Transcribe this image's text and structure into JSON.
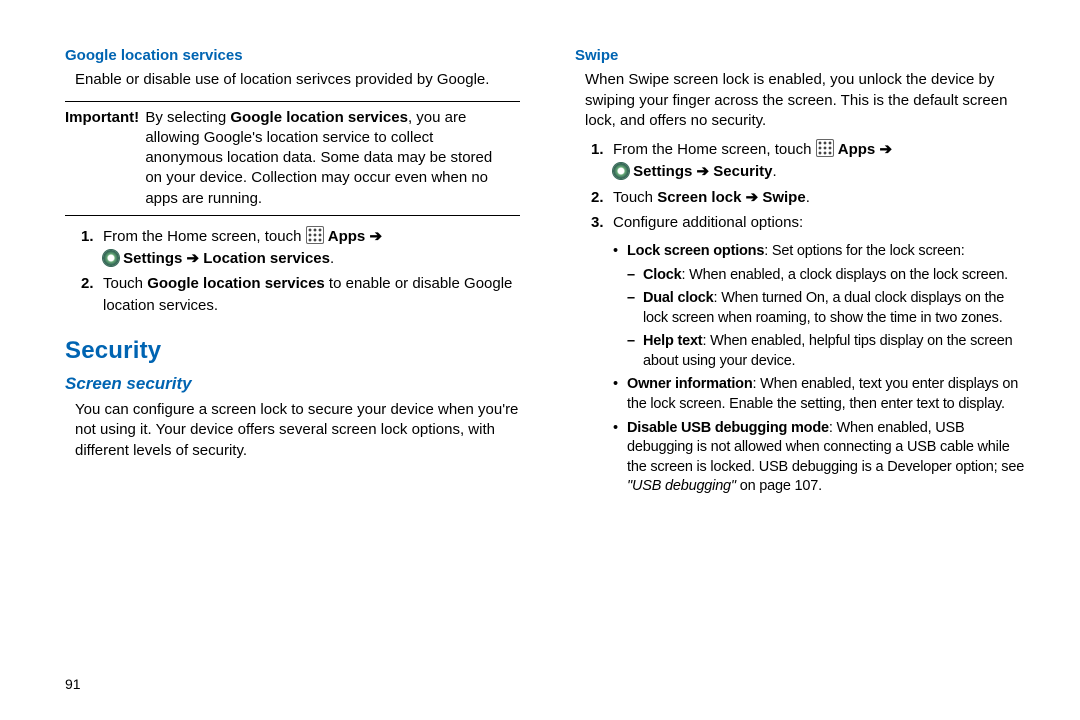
{
  "left": {
    "h_google": "Google location services",
    "google_intro": "Enable or disable use of location serivces provided by Google.",
    "important_label": "Important!",
    "important_a": "By selecting ",
    "important_b": "Google location services",
    "important_c": ", you are allowing Google's location service to collect anonymous location data. Some data may be stored on your device. Collection may occur even when no apps are running.",
    "step1_a": "From the Home screen, touch ",
    "step1_apps": " Apps ",
    "arrow": "➔",
    "step1_settings": " Settings ",
    "step1_loc": " Location services",
    "step2_a": "Touch ",
    "step2_b": "Google location services",
    "step2_c": " to enable or disable Google location services.",
    "h_security": "Security",
    "h_screen": "Screen security",
    "screen_para": "You can configure a screen lock to secure your device when you're not using it. Your device offers several screen lock options, with different levels of security."
  },
  "right": {
    "h_swipe": "Swipe",
    "swipe_intro": "When Swipe screen lock is enabled, you unlock the device by swiping your finger across the screen. This is the default screen lock, and offers no security.",
    "step1_a": "From the Home screen, touch ",
    "step1_apps": " Apps ",
    "arrow": "➔",
    "step1_settings": " Settings ",
    "step1_security": " Security",
    "step2_a": "Touch ",
    "step2_b": "Screen lock ",
    "step2_c": " Swipe",
    "period": ".",
    "step3": "Configure additional options:",
    "b1_a": "Lock screen options",
    "b1_b": ": Set options for the lock screen:",
    "d1_a": "Clock",
    "d1_b": ": When enabled, a clock displays on the lock screen.",
    "d2_a": "Dual clock",
    "d2_b": ": When turned On, a dual clock displays on the lock screen when roaming, to show the time in two zones.",
    "d3_a": "Help text",
    "d3_b": ": When enabled, helpful tips display on the screen about using your device.",
    "b2_a": "Owner information",
    "b2_b": ": When enabled, text you enter displays on the lock screen. Enable the setting, then enter text to display.",
    "b3_a": "Disable USB debugging mode",
    "b3_b": ": When enabled, USB debugging is not allowed when connecting a USB cable while the screen is locked. USB debugging is a Developer option; see ",
    "b3_c": "\"USB debugging\"",
    "b3_d": " on page 107."
  },
  "pagenum": "91"
}
